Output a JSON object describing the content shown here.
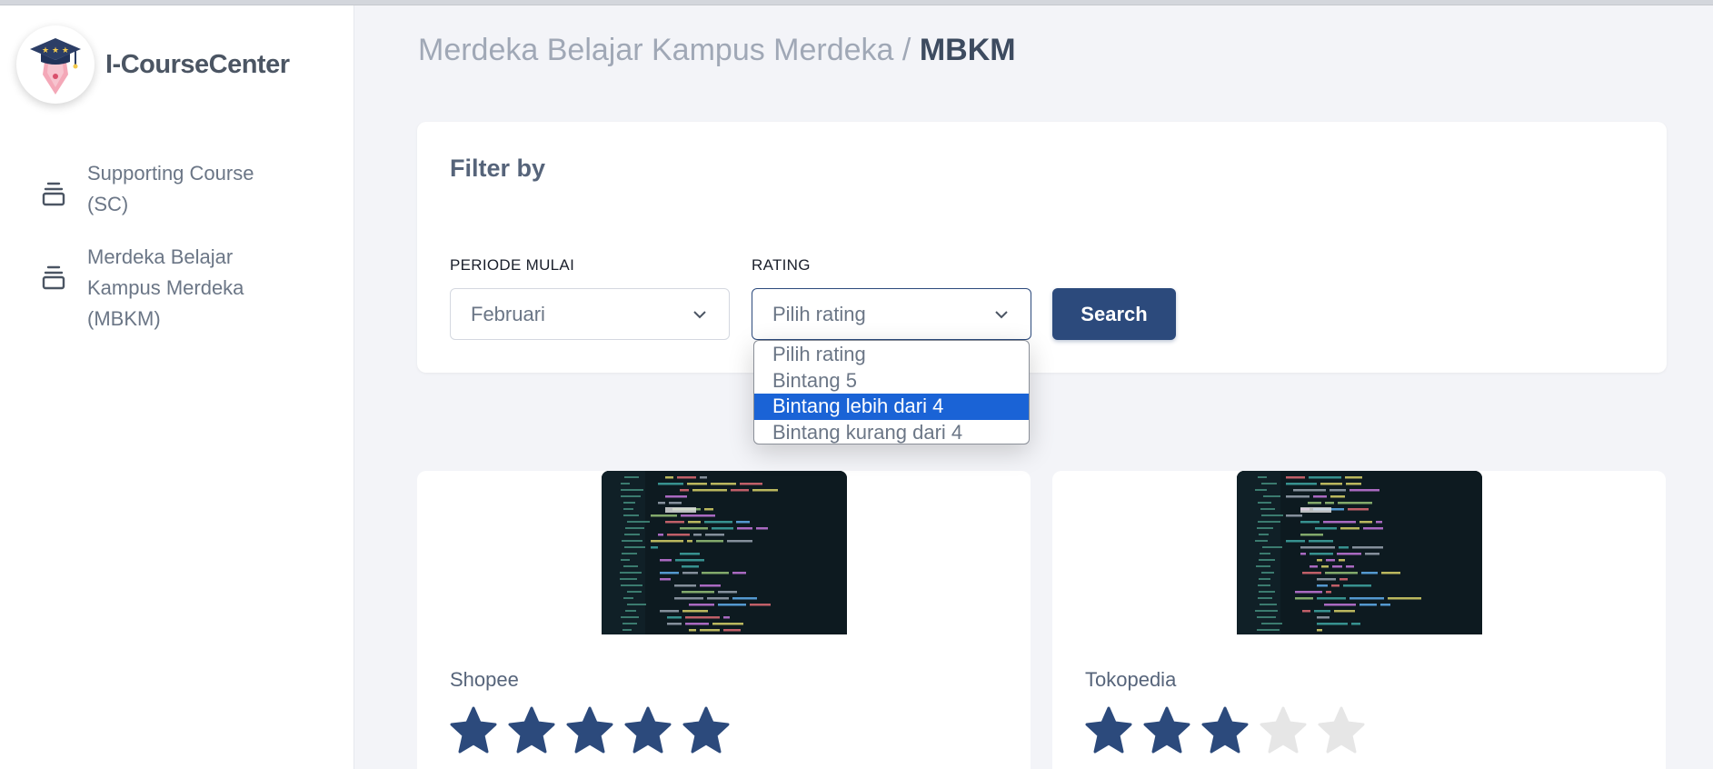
{
  "brand": {
    "name": "I-CourseCenter"
  },
  "sidebar": {
    "items": [
      {
        "label": "Supporting Course (SC)"
      },
      {
        "label": "Merdeka Belajar Kampus Merdeka (MBKM)"
      }
    ]
  },
  "breadcrumb": {
    "parent": "Merdeka Belajar Kampus Merdeka /",
    "current": "MBKM"
  },
  "filter": {
    "title": "Filter by",
    "periode": {
      "label": "PERIODE MULAI",
      "value": "Februari"
    },
    "rating": {
      "label": "RATING",
      "value": "Pilih rating",
      "options": [
        "Pilih rating",
        "Bintang 5",
        "Bintang lebih dari 4",
        "Bintang kurang dari 4"
      ],
      "highlighted_index": 2
    },
    "search_label": "Search"
  },
  "courses": [
    {
      "name": "Shopee",
      "rating": 5,
      "max_rating": 5
    },
    {
      "name": "Tokopedia",
      "rating": 3,
      "max_rating": 5
    }
  ],
  "colors": {
    "primary": "#2c4a7c",
    "star_filled": "#2c4a7c",
    "star_empty": "#e6e6e6",
    "highlight": "#1a63d6"
  }
}
